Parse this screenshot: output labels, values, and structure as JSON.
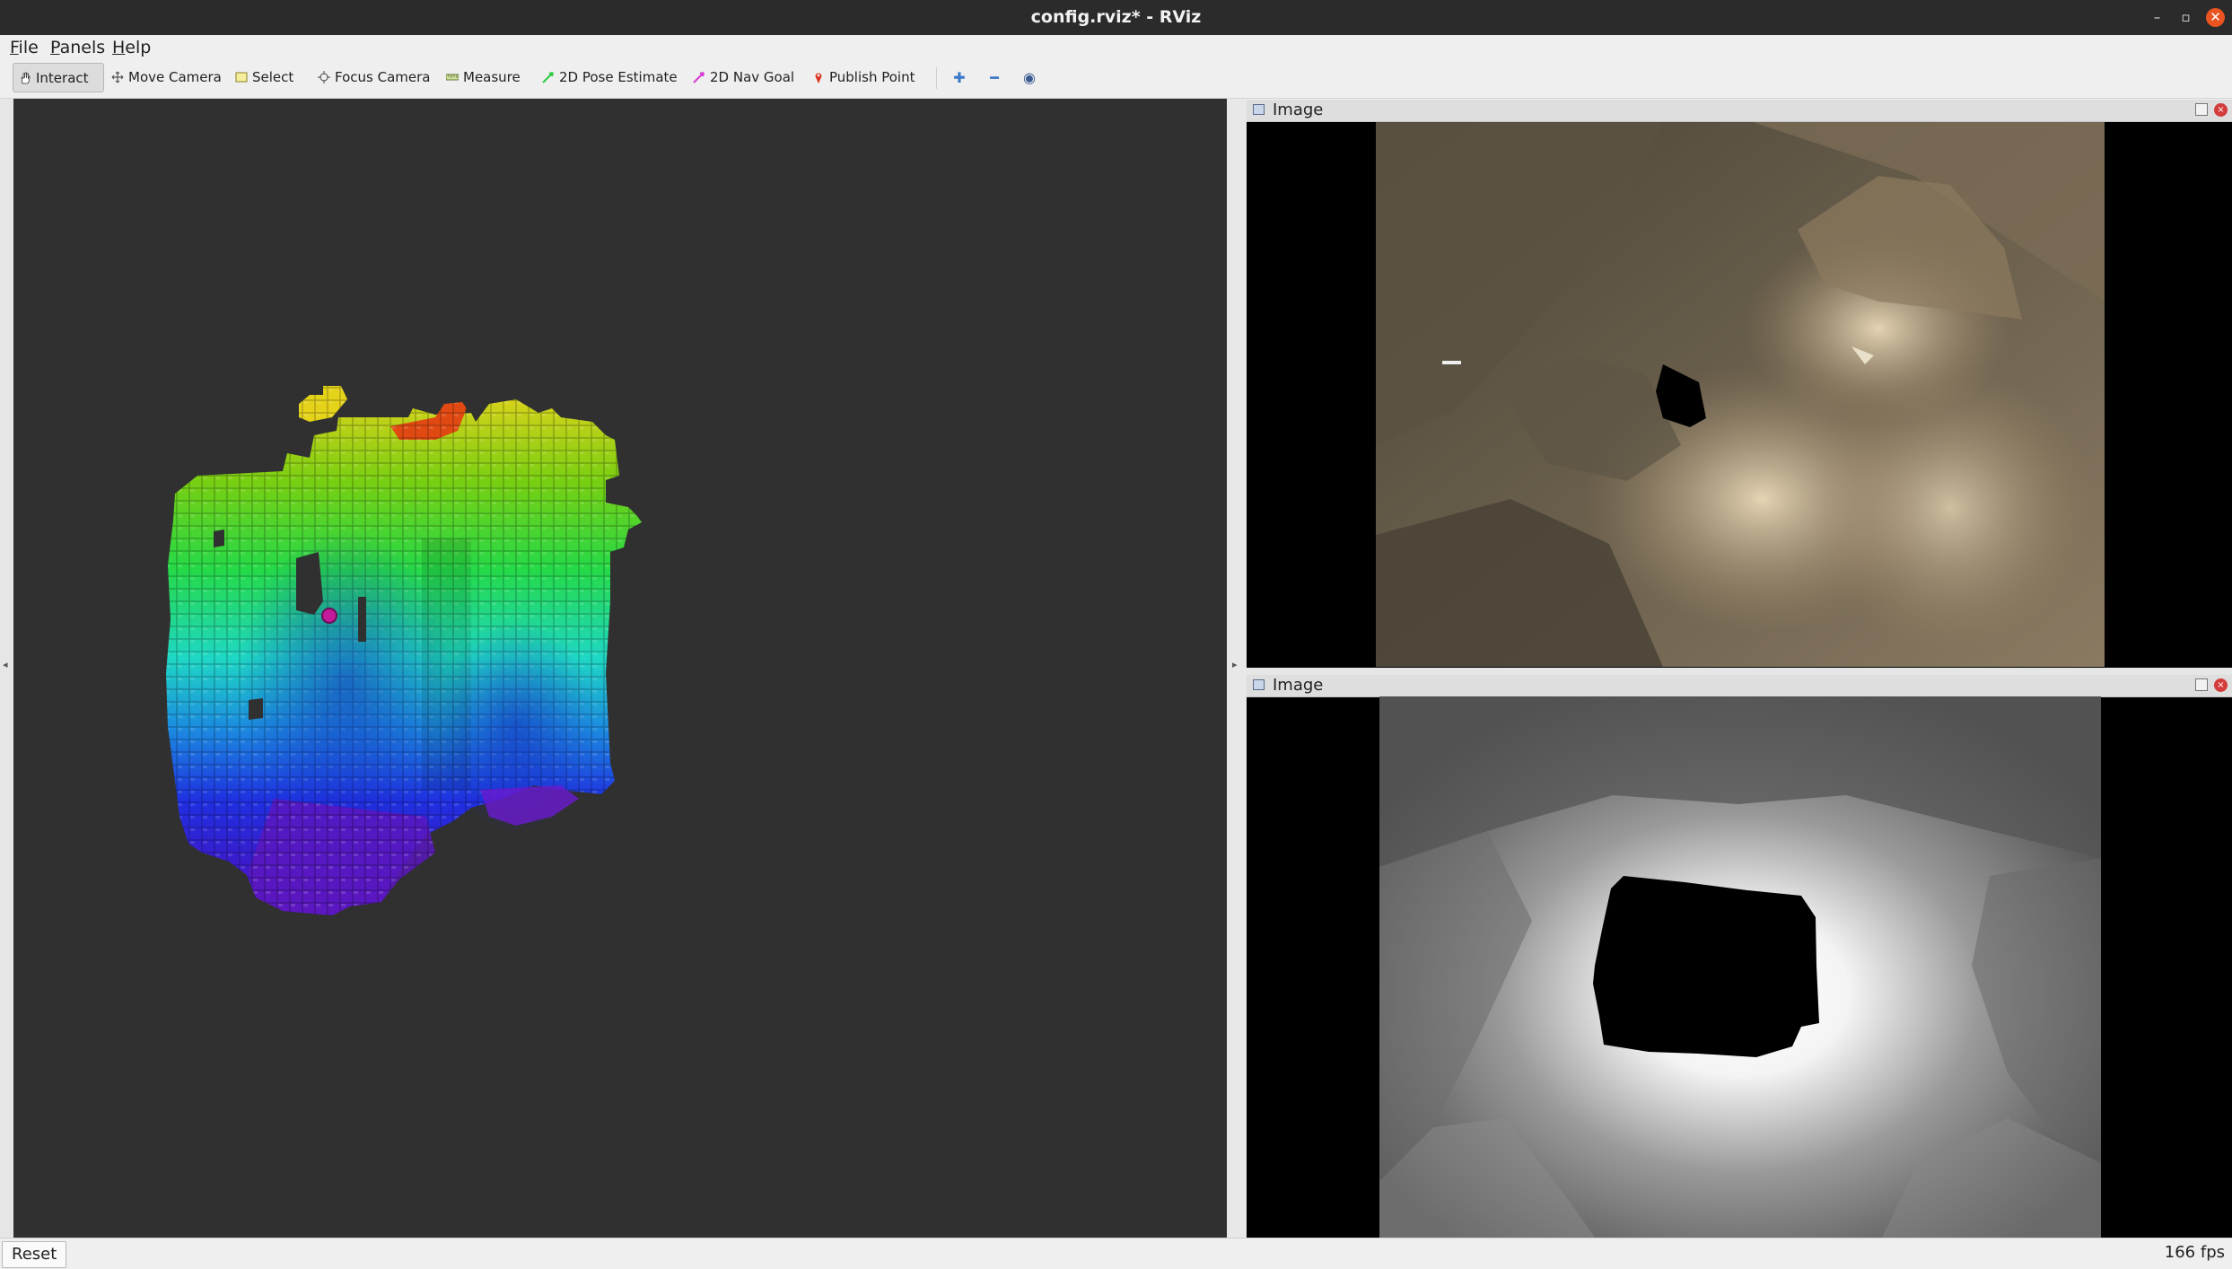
{
  "window": {
    "title": "config.rviz* - RViz"
  },
  "menu": {
    "items": [
      {
        "accel": "F",
        "rest": "ile"
      },
      {
        "accel": "P",
        "rest": "anels"
      },
      {
        "accel": "H",
        "rest": "elp"
      }
    ]
  },
  "toolbar": {
    "tools": [
      {
        "label": "Interact",
        "active": true,
        "icon": "hand-icon"
      },
      {
        "label": "Move Camera",
        "icon": "move-camera-icon"
      },
      {
        "label": "Select",
        "icon": "select-icon"
      },
      {
        "label": "Focus Camera",
        "icon": "focus-camera-icon"
      },
      {
        "label": "Measure",
        "icon": "measure-icon"
      },
      {
        "label": "2D Pose Estimate",
        "icon": "pose-arrow-icon",
        "color": "#2ecc40"
      },
      {
        "label": "2D Nav Goal",
        "icon": "nav-arrow-icon",
        "color": "#d63ad6"
      },
      {
        "label": "Publish Point",
        "icon": "pin-icon",
        "color": "#d9331f"
      }
    ]
  },
  "panels": {
    "top": {
      "title": "Image"
    },
    "bottom": {
      "title": "Image"
    }
  },
  "status": {
    "reset_label": "Reset",
    "fps": "166 fps"
  },
  "colors": {
    "viewport_bg": "#303030",
    "titlebar": "#2b2b2b",
    "close_button": "#e95420"
  }
}
